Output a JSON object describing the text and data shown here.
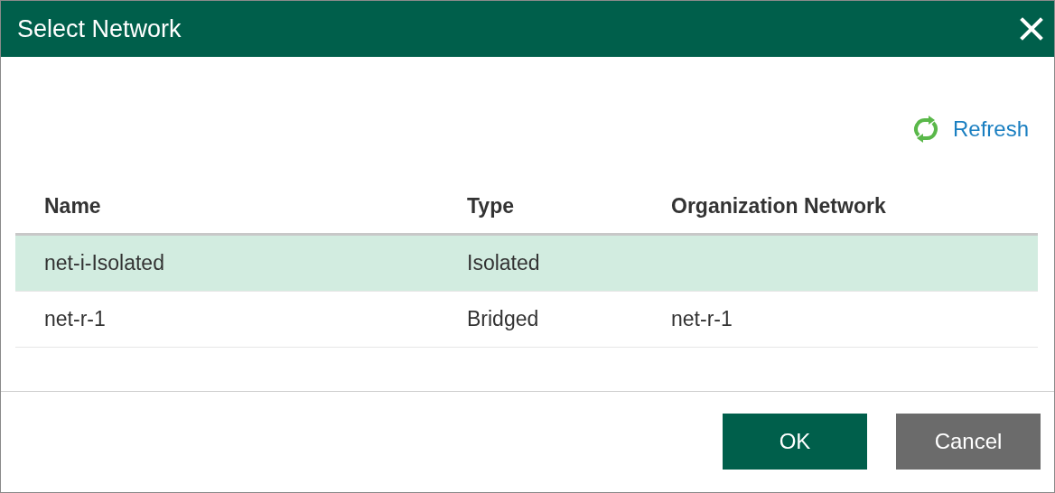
{
  "window": {
    "title": "Select Network"
  },
  "toolbar": {
    "refresh": "Refresh"
  },
  "table": {
    "columns": [
      "Name",
      "Type",
      "Organization Network"
    ],
    "rows": [
      {
        "cells": [
          "net-i-Isolated",
          "Isolated",
          ""
        ],
        "selected": true
      },
      {
        "cells": [
          "net-r-1",
          "Bridged",
          "net-r-1"
        ],
        "selected": false
      }
    ]
  },
  "buttons": [
    {
      "label": "OK",
      "kind": "primary"
    },
    {
      "label": "Cancel",
      "kind": "secondary"
    }
  ]
}
